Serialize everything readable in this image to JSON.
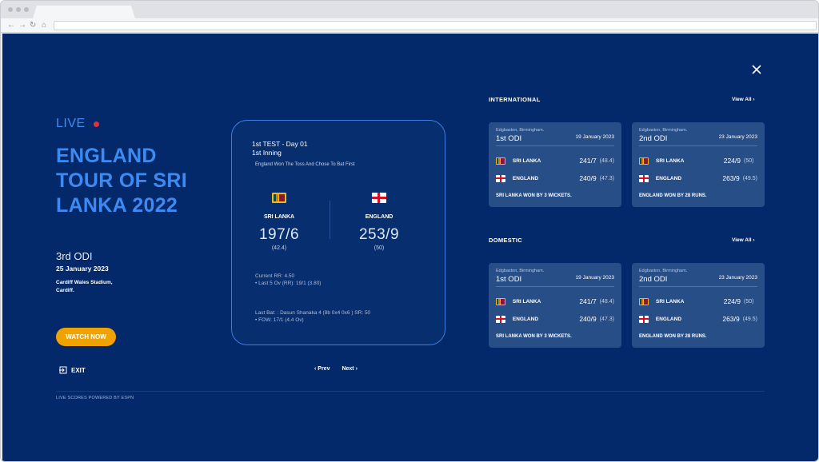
{
  "browser": {
    "url": ""
  },
  "live_label": "LIVE",
  "tour_title": "ENGLAND TOUR OF SRI LANKA 2022",
  "match_no": "3rd ODI",
  "match_date": "25 January 2023",
  "venue": "Cardiff Wales Stadium, Cardiff.",
  "watch_label": "WATCH NOW",
  "exit_label": "EXIT",
  "powered_by": "LIVE SCORES POWERED BY ESPN",
  "score_card": {
    "title_line1": "1st TEST - Day 01",
    "title_line2": "1st Inning",
    "toss": "England Won The Toss And Chose To Bat First",
    "team1": {
      "name": "SRI LANKA",
      "score": "197/6",
      "overs": "(42.4)",
      "flag": "sri-lanka-flag"
    },
    "team2": {
      "name": "ENGLAND",
      "score": "253/9",
      "overs": "(50)",
      "flag": "england-flag"
    },
    "current_rr": "Current RR: 4.50",
    "last5": "• Last 5 Ov (RR): 19/1 (3.80)",
    "last_bat": "Last Bat: : Dasun Shanaka 4 (8b 0x4 0x6 ) SR: 50",
    "fow": "• FOW: 17/1 (4.4 Ov)"
  },
  "pager": {
    "prev": "Prev",
    "next": "Next"
  },
  "sections": [
    {
      "heading": "INTERNATIONAL",
      "view_all": "View All",
      "cards": [
        {
          "venue": "Edgbaston, Birmingham.",
          "match": "1st ODI",
          "date": "19 January 2023",
          "rows": [
            {
              "team": "SRI LANKA",
              "score": "241/7",
              "overs": "(48.4)"
            },
            {
              "team": "ENGLAND",
              "score": "240/9",
              "overs": "(47.3)"
            }
          ],
          "result": "SRI LANKA WON BY 3 WICKETS."
        },
        {
          "venue": "Edgbaston, Birmingham.",
          "match": "2nd ODI",
          "date": "23 January 2023",
          "rows": [
            {
              "team": "SRI LANKA",
              "score": "224/9",
              "overs": "(50)"
            },
            {
              "team": "ENGLAND",
              "score": "263/9",
              "overs": "(49.5)"
            }
          ],
          "result": "ENGLAND WON BY 28 RUNS."
        }
      ]
    },
    {
      "heading": "DOMESTIC",
      "view_all": "View All",
      "cards": [
        {
          "venue": "Edgbaston, Birmingham.",
          "match": "1st ODI",
          "date": "19 January 2023",
          "rows": [
            {
              "team": "SRI LANKA",
              "score": "241/7",
              "overs": "(48.4)"
            },
            {
              "team": "ENGLAND",
              "score": "240/9",
              "overs": "(47.3)"
            }
          ],
          "result": "SRI LANKA WON BY 3 WICKETS."
        },
        {
          "venue": "Edgbaston, Birmingham.",
          "match": "2nd ODI",
          "date": "23 January 2023",
          "rows": [
            {
              "team": "SRI LANKA",
              "score": "224/9",
              "overs": "(50)"
            },
            {
              "team": "ENGLAND",
              "score": "263/9",
              "overs": "(49.5)"
            }
          ],
          "result": "ENGLAND WON BY 28 RUNS."
        }
      ]
    }
  ],
  "colors": {
    "background": "#03296a",
    "accent": "#3d8bf2",
    "watch_button": "#f0a300",
    "live_dot": "#e0323c",
    "card": "#284e88"
  }
}
